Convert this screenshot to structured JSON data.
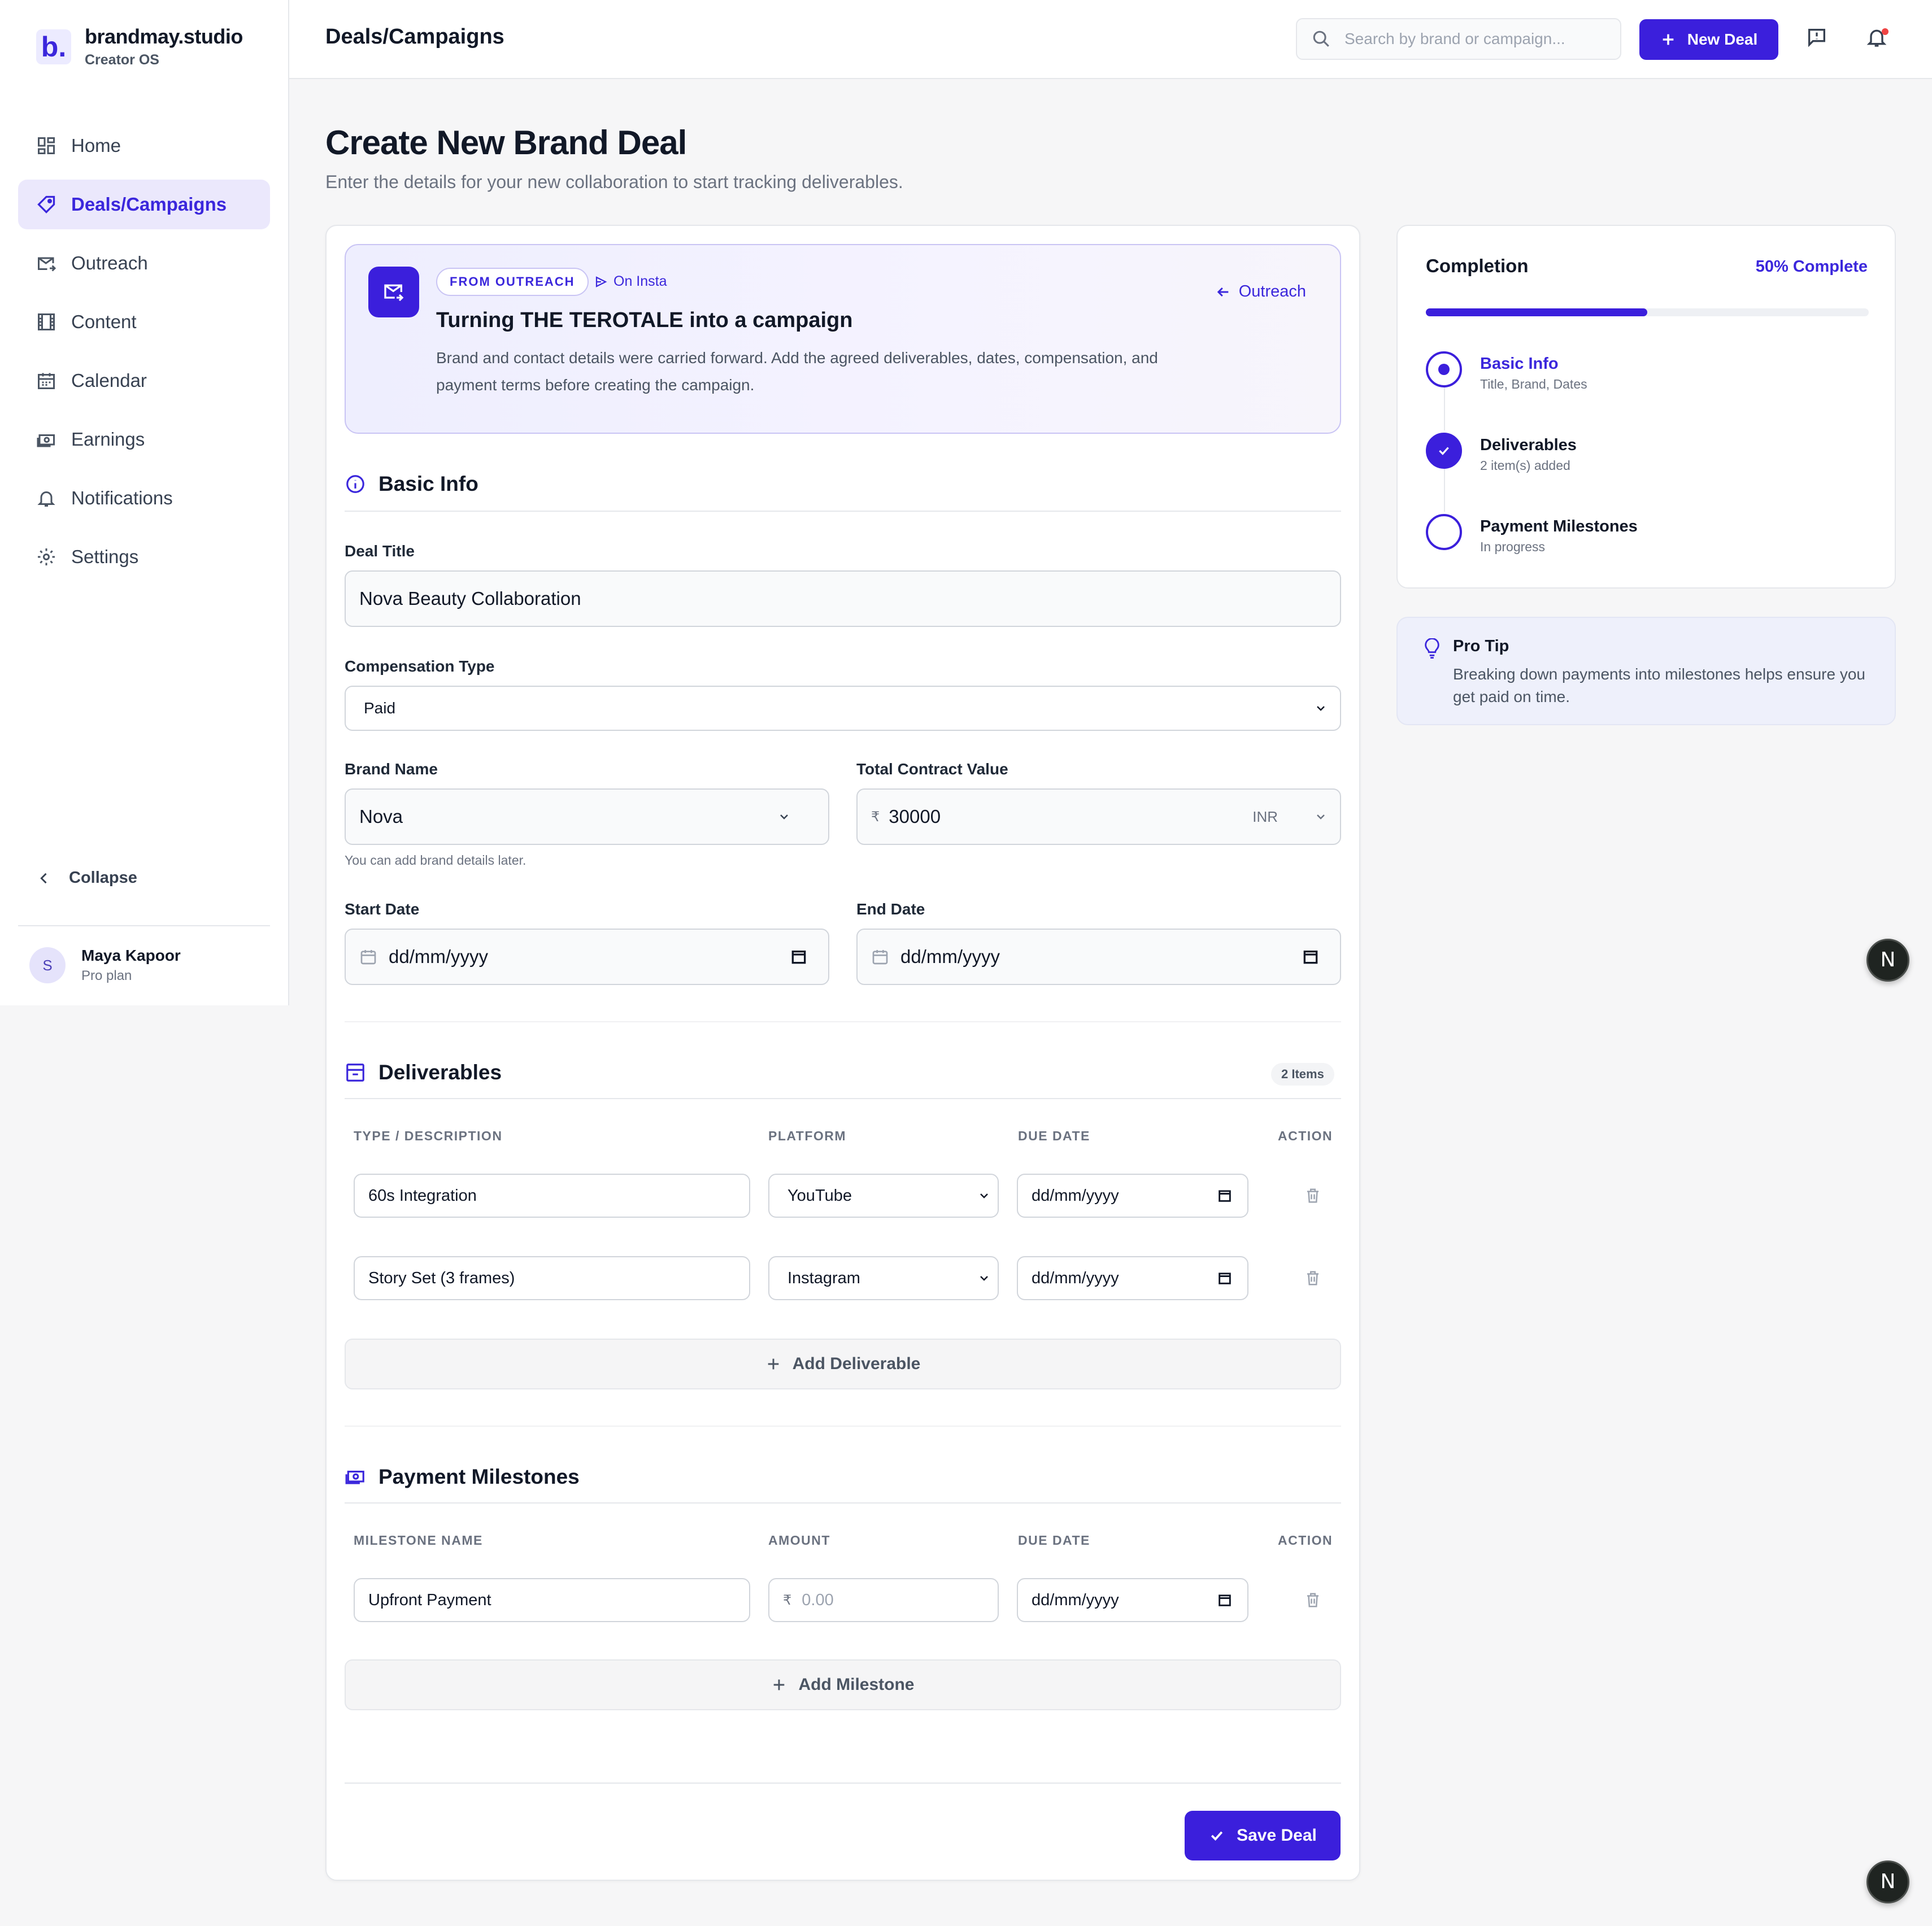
{
  "app": {
    "name": "brandmay.studio",
    "subtitle": "Creator OS",
    "logo_letter": "b."
  },
  "sidebar": {
    "items": [
      {
        "label": "Home",
        "icon": "grid-icon"
      },
      {
        "label": "Deals/Campaigns",
        "icon": "tag-icon",
        "active": true
      },
      {
        "label": "Outreach",
        "icon": "mail-send-icon"
      },
      {
        "label": "Content",
        "icon": "film-icon"
      },
      {
        "label": "Calendar",
        "icon": "calendar-icon"
      },
      {
        "label": "Earnings",
        "icon": "money-icon"
      },
      {
        "label": "Notifications",
        "icon": "bell-icon"
      },
      {
        "label": "Settings",
        "icon": "gear-icon"
      }
    ],
    "collapse_label": "Collapse",
    "user": {
      "initial": "S",
      "name": "Maya Kapoor",
      "plan": "Pro plan"
    }
  },
  "topbar": {
    "title": "Deals/Campaigns",
    "search_placeholder": "Search by brand or campaign...",
    "new_deal_label": "New Deal"
  },
  "page": {
    "title": "Create New Brand Deal",
    "subtitle": "Enter the details for your new collaboration to start tracking deliverables."
  },
  "banner": {
    "badge": "FROM OUTREACH",
    "source": "On Insta",
    "title": "Turning THE TEROTALE into a campaign",
    "description": "Brand and contact details were carried forward. Add the agreed deliverables, dates, compensation, and payment terms before creating the campaign.",
    "back_label": "Outreach"
  },
  "basic_info": {
    "heading": "Basic Info",
    "deal_title_label": "Deal Title",
    "deal_title_value": "Nova Beauty Collaboration",
    "compensation_label": "Compensation Type",
    "compensation_value": "Paid",
    "brand_label": "Brand Name",
    "brand_value": "Nova",
    "brand_hint": "You can add brand details later.",
    "contract_label": "Total Contract Value",
    "currency_symbol": "₹",
    "contract_value": "30000",
    "currency": "INR",
    "start_label": "Start Date",
    "end_label": "End Date",
    "date_placeholder": "dd/mm/yyyy"
  },
  "deliverables": {
    "heading": "Deliverables",
    "count_badge": "2 Items",
    "columns": [
      "TYPE / DESCRIPTION",
      "PLATFORM",
      "DUE DATE",
      "ACTION"
    ],
    "rows": [
      {
        "description": "60s Integration",
        "platform": "YouTube",
        "due": "dd/mm/yyyy"
      },
      {
        "description": "Story Set (3 frames)",
        "platform": "Instagram",
        "due": "dd/mm/yyyy"
      }
    ],
    "add_label": "Add Deliverable"
  },
  "milestones": {
    "heading": "Payment Milestones",
    "columns": [
      "MILESTONE NAME",
      "AMOUNT",
      "DUE DATE",
      "ACTION"
    ],
    "rows": [
      {
        "name": "Upfront Payment",
        "currency_symbol": "₹",
        "amount_placeholder": "0.00",
        "due": "dd/mm/yyyy"
      }
    ],
    "add_label": "Add Milestone"
  },
  "save_label": "Save Deal",
  "completion": {
    "title": "Completion",
    "percent_label": "50% Complete",
    "progress": 0.5,
    "steps": [
      {
        "name": "Basic Info",
        "sub": "Title, Brand, Dates",
        "state": "current"
      },
      {
        "name": "Deliverables",
        "sub": "2 item(s) added",
        "state": "done"
      },
      {
        "name": "Payment Milestones",
        "sub": "In progress",
        "state": "pending"
      }
    ]
  },
  "tip": {
    "title": "Pro Tip",
    "text": "Breaking down payments into milestones helps ensure you get paid on time."
  },
  "fab_letter": "N",
  "colors": {
    "accent": "#3b1fdc",
    "accent_soft": "#ebe8fc",
    "notification_dot": "#ef4444"
  }
}
